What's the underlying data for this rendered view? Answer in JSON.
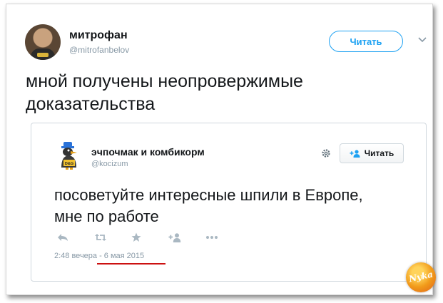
{
  "tweet": {
    "author_name": "митрофан",
    "author_handle": "@mitrofanbelov",
    "follow_label": "Читать",
    "text": "мной получены неопровержимые доказательства"
  },
  "quoted": {
    "author_name": "эчпочмак и комбикорм",
    "author_handle": "@kocizum",
    "follow_label": "Читать",
    "avatar_caption": "D&G",
    "text": "посоветуйте интересные шпили в Европе, мне по работе",
    "timestamp": "2:48 вечера - 6 мая 2015",
    "actions": [
      "reply-icon",
      "retweet-icon",
      "like-icon",
      "follow-add-icon",
      "more-icon"
    ]
  },
  "watermark": {
    "text": "Nyka"
  },
  "colors": {
    "accent": "#1da1f2",
    "muted": "#8899a6",
    "text": "#14171a",
    "highlight_underline": "#cc1111"
  }
}
